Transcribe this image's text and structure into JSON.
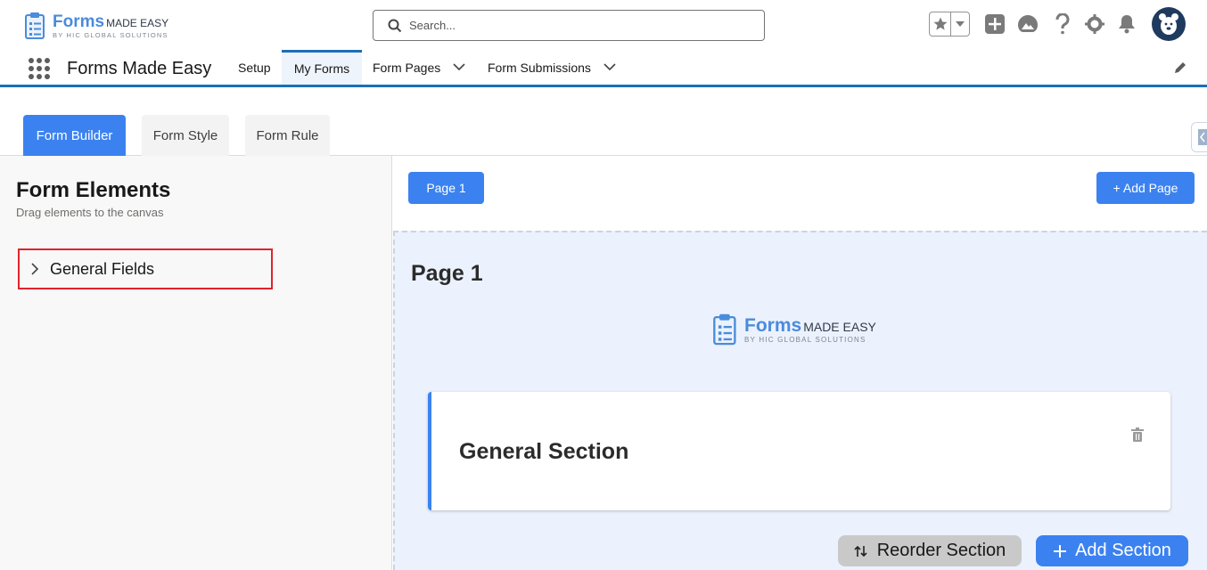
{
  "header": {
    "logo": {
      "main": "Forms",
      "made": "MADE EASY",
      "sub": "BY HIC GLOBAL SOLUTIONS"
    },
    "search": {
      "placeholder": "Search..."
    },
    "icons": [
      "favorites-star-icon",
      "add-icon",
      "trailhead-icon",
      "help-icon",
      "setup-gear-icon",
      "notification-bell-icon",
      "user-avatar"
    ]
  },
  "nav": {
    "app_name": "Forms Made Easy",
    "items": [
      {
        "label": "Setup"
      },
      {
        "label": "My Forms"
      },
      {
        "label": "Form Pages"
      },
      {
        "label": "Form Submissions"
      }
    ]
  },
  "tabs": [
    {
      "label": "Form Builder"
    },
    {
      "label": "Form Style"
    },
    {
      "label": "Form Rule"
    }
  ],
  "left_panel": {
    "title": "Form Elements",
    "subtitle": "Drag elements to the canvas",
    "group": "General Fields"
  },
  "canvas": {
    "page_button": "Page 1",
    "add_page": "+ Add Page",
    "page_title": "Page 1",
    "logo": {
      "main": "Forms",
      "made": "MADE EASY",
      "sub": "BY HIC GLOBAL SOLUTIONS"
    },
    "section_title": "General Section",
    "reorder_label": "Reorder Section",
    "add_section_label": "Add Section"
  },
  "colors": {
    "accent": "#3b82f0",
    "nav_border": "#1b6fb6",
    "highlight": "#e0232b",
    "canvas_bg": "#ecf2fd"
  }
}
